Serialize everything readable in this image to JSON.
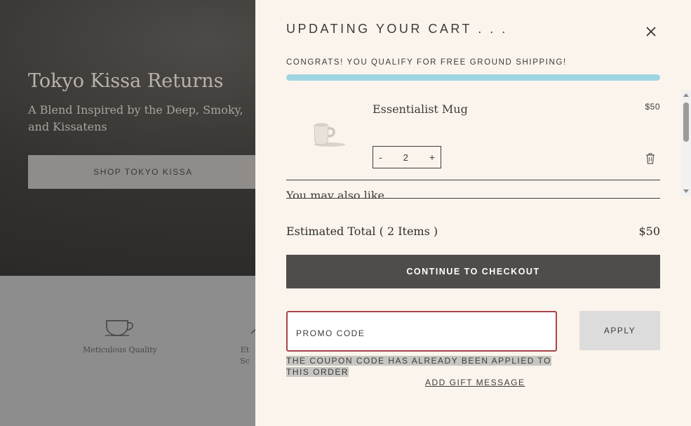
{
  "background_page": {
    "hero_title": "Tokyo Kissa Returns",
    "hero_subtitle": "A Blend Inspired by the Deep, Smoky, and Kissatens",
    "hero_button": "SHOP TOKYO KISSA",
    "features": [
      {
        "label": "Meticulous Quality",
        "icon": "cup-icon"
      },
      {
        "label": "Et Sc",
        "icon": "spoon-icon"
      }
    ]
  },
  "drawer": {
    "title": "UPDATING YOUR CART . . .",
    "shipping_message": "CONGRATS! YOU QUALIFY FOR FREE GROUND SHIPPING!",
    "shipping_progress": 1.0,
    "item": {
      "name": "Essentialist Mug",
      "price": "$50",
      "quantity": "2",
      "decrement": "-",
      "increment": "+"
    },
    "also_like": "You may also like",
    "total_label": "Estimated Total ( 2 Items )",
    "total_value": "$50",
    "checkout_button": "CONTINUE TO CHECKOUT",
    "promo_placeholder": "PROMO CODE",
    "apply_button": "APPLY",
    "coupon_error": "THE COUPON CODE HAS ALREADY BEEN APPLIED TO THIS ORDER",
    "gift_message_link": "ADD GIFT MESSAGE"
  },
  "colors": {
    "progress": "#9fd5e1",
    "checkout": "#4f4d4c",
    "error_border": "#a8454a",
    "drawer_bg": "#faf4ec"
  }
}
